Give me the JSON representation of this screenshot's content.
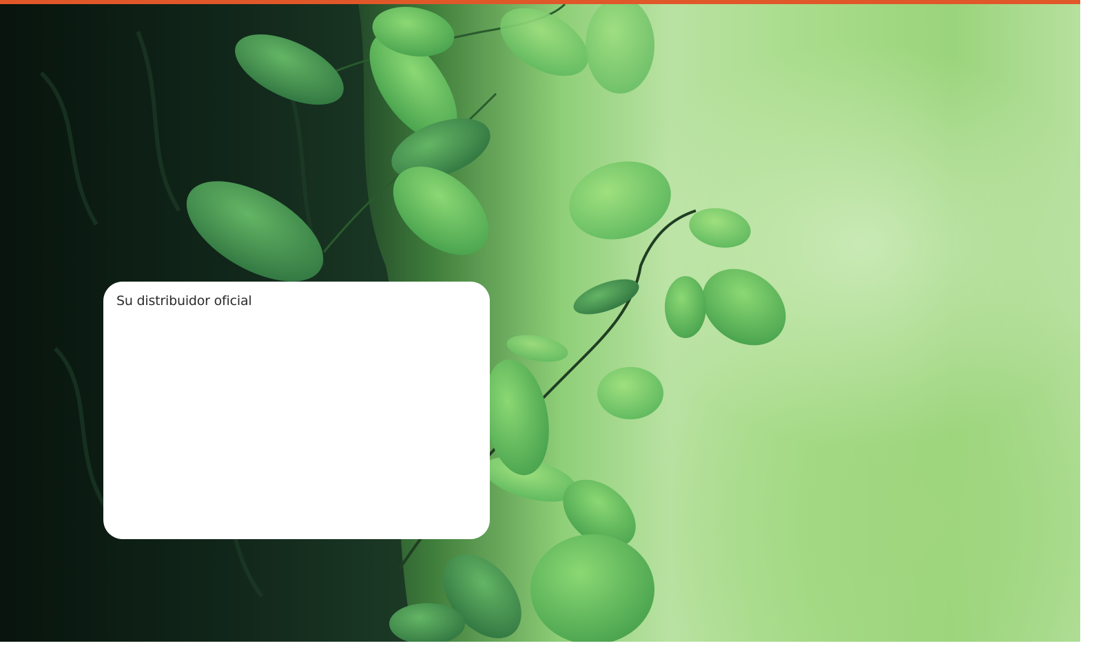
{
  "distributor_box": {
    "label": "Su distribuidor oficial"
  },
  "colors": {
    "accent_bar": "#e0572a",
    "box_background": "#ffffff",
    "trunk": "#0d1f15",
    "leaf_light": "#7fd06a",
    "leaf_dark": "#3b9a4b",
    "background_blur": "#b9e2a2"
  }
}
